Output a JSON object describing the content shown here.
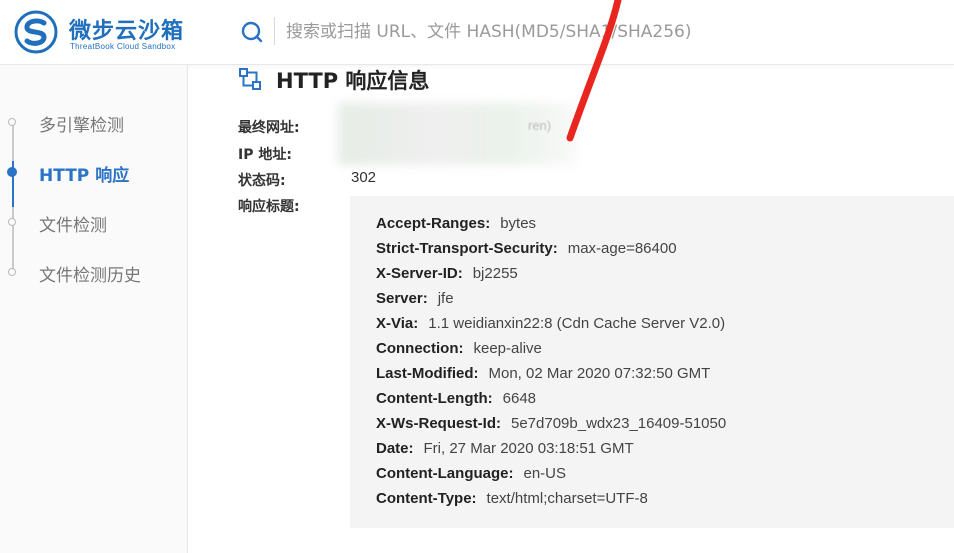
{
  "header": {
    "logo_title": "微步云沙箱",
    "logo_subtitle": "ThreatBook Cloud Sandbox",
    "search_placeholder": "搜索或扫描 URL、文件 HASH(MD5/SHA1/SHA256)",
    "search_value": ""
  },
  "sidebar": {
    "items": [
      {
        "label": "多引擎检测",
        "active": false
      },
      {
        "label": "HTTP 响应",
        "active": true
      },
      {
        "label": "文件检测",
        "active": false
      },
      {
        "label": "文件检测历史",
        "active": false
      }
    ]
  },
  "main": {
    "section_title": "HTTP 响应信息",
    "fields": {
      "final_url_label": "最终网址:",
      "final_url_tail": "ren)",
      "ip_label": "IP 地址:",
      "status_label": "状态码:",
      "status_value": "302",
      "headers_label": "响应标题:"
    },
    "response_headers": [
      {
        "key": "Accept-Ranges:",
        "value": "bytes"
      },
      {
        "key": "Strict-Transport-Security:",
        "value": "max-age=86400"
      },
      {
        "key": "X-Server-ID:",
        "value": "bj2255"
      },
      {
        "key": "Server:",
        "value": "jfe"
      },
      {
        "key": "X-Via:",
        "value": "1.1 weidianxin22:8 (Cdn Cache Server V2.0)"
      },
      {
        "key": "Connection:",
        "value": "keep-alive"
      },
      {
        "key": "Last-Modified:",
        "value": "Mon, 02 Mar 2020 07:32:50 GMT"
      },
      {
        "key": "Content-Length:",
        "value": "6648"
      },
      {
        "key": "X-Ws-Request-Id:",
        "value": "5e7d709b_wdx23_16409-51050"
      },
      {
        "key": "Date:",
        "value": "Fri, 27 Mar 2020 03:18:51 GMT"
      },
      {
        "key": "Content-Language:",
        "value": "en-US"
      },
      {
        "key": "Content-Type:",
        "value": "text/html;charset=UTF-8"
      }
    ]
  },
  "colors": {
    "brand": "#1f6fbd",
    "active": "#2a73c6",
    "annotation": "#e8261f"
  }
}
